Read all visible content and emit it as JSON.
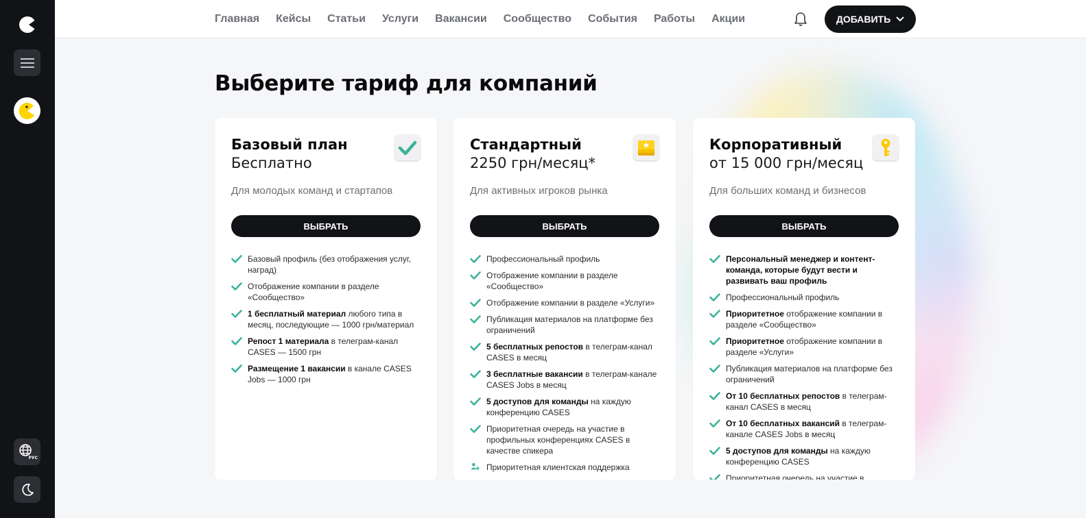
{
  "sidebar": {
    "logo_icon": "cases-logo-icon",
    "menu_icon": "hamburger-icon",
    "avatar_icon": "pacman-avatar-icon",
    "lang_label": "РУС",
    "theme_icon": "moon-icon"
  },
  "nav": {
    "items": [
      "Главная",
      "Кейсы",
      "Статьи",
      "Услуги",
      "Вакансии",
      "Сообщество",
      "События",
      "Работы",
      "Акции"
    ],
    "bell_icon": "bell-icon",
    "add_label": "ДОБАВИТЬ"
  },
  "page": {
    "title": "Выберите тариф для компаний"
  },
  "colors": {
    "accent_check": "#3bb29a",
    "dark": "#121316"
  },
  "plans": [
    {
      "name": "Базовый план",
      "price": "Бесплатно",
      "desc": "Для молодых команд и стартапов",
      "icon": "checkmark-badge-icon",
      "button": "ВЫБРАТЬ",
      "features": [
        {
          "bold": "",
          "text": "Базовый профиль (без отображения услуг, наград)"
        },
        {
          "bold": "",
          "text": "Отображение компании в разделе «Сообщество»"
        },
        {
          "bold": "1 бесплатный материал",
          "text": " любого типа в месяц, последующие — 1000 грн/материал"
        },
        {
          "bold": "Репост 1 материала",
          "text": " в телеграм-канал CASES — 1500 грн"
        },
        {
          "bold": "Размещение 1 вакансии",
          "text": " в канале CASES Jobs — 1000 грн"
        }
      ]
    },
    {
      "name": "Стандартный",
      "price": "2250 грн/месяц*",
      "desc": "Для активных игроков рынка",
      "icon": "star-stack-icon",
      "button": "ВЫБРАТЬ",
      "features": [
        {
          "bold": "",
          "text": "Профессиональный профиль"
        },
        {
          "bold": "",
          "text": "Отображение компании в разделе «Сообщество»"
        },
        {
          "bold": "",
          "text": "Отображение компании в разделе «Услуги»"
        },
        {
          "bold": "",
          "text": "Публикация материалов на платформе без ограничений"
        },
        {
          "bold": "5 бесплатных репостов",
          "text": " в телеграм-канал CASES в месяц"
        },
        {
          "bold": "3 бесплатные вакансии",
          "text": " в телеграм-канале CASES Jobs в месяц"
        },
        {
          "bold": "5 доступов для команды",
          "text": " на каждую конференцию CASES"
        },
        {
          "bold": "",
          "text": "Приоритетная очередь на участие в профильных конференциях CASES в качестве спикера"
        },
        {
          "bold": "",
          "text": "Приоритетная клиентская поддержка",
          "icon": "support-plus-icon"
        }
      ]
    },
    {
      "name": "Корпоративный",
      "price": "от 15 000 грн/месяц",
      "desc": "Для больших команд и бизнесов",
      "icon": "key-icon",
      "button": "ВЫБРАТЬ",
      "features": [
        {
          "bold": "Персональный менеджер и контент-команда, которые будут вести и развивать ваш профиль",
          "text": ""
        },
        {
          "bold": "",
          "text": "Профессиональный профиль"
        },
        {
          "bold": "Приоритетное",
          "text": " отображение компании в разделе «Сообщество»"
        },
        {
          "bold": "Приоритетное",
          "text": " отображение компании в разделе «Услуги»"
        },
        {
          "bold": "",
          "text": "Публикация материалов на платформе без ограничений"
        },
        {
          "bold": "От 10 бесплатных репостов",
          "text": " в телеграм-канал CASES в месяц"
        },
        {
          "bold": "От 10 бесплатных вакансий",
          "text": " в телеграм-канале CASES Jobs в месяц"
        },
        {
          "bold": "5 доступов для команды",
          "text": " на каждую конференцию CASES"
        },
        {
          "bold": "",
          "text": "Приоритетная очередь на участие в"
        }
      ]
    }
  ]
}
